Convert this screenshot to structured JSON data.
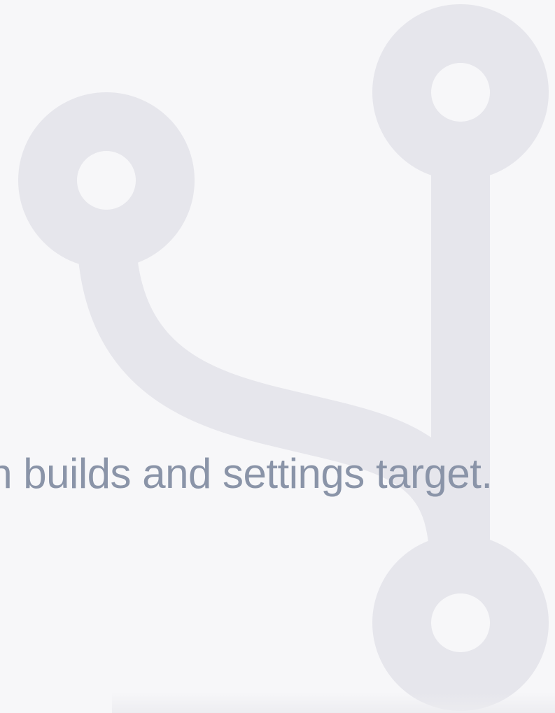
{
  "content": {
    "caption": "Branch builds and settings target."
  },
  "colors": {
    "background": "#f7f7f9",
    "icon": "#e6e6ec",
    "caption_text": "#8a94a8"
  },
  "icons": {
    "decorative": "git-branch-icon"
  }
}
